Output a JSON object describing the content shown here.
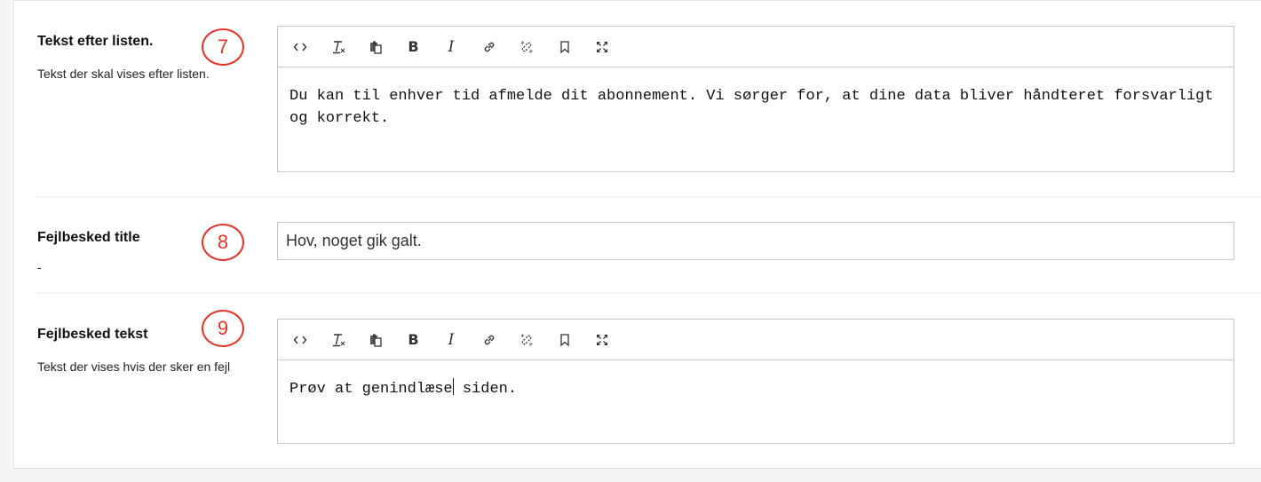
{
  "fields": [
    {
      "label": "Tekst efter listen.",
      "description": "Tekst der skal vises efter listen.",
      "badge": "7",
      "content": "Du kan til enhver tid afmelde dit abonnement. Vi sørger for, at dine data bliver håndteret forsvarligt og korrekt."
    },
    {
      "label": "Fejlbesked title",
      "description": "-",
      "badge": "8",
      "value": "Hov, noget gik galt."
    },
    {
      "label": "Fejlbesked tekst",
      "description": "Tekst der vises hvis der sker en fejl",
      "badge": "9",
      "content_before_cursor": "Prøv at genindlæse",
      "content_after_cursor": " siden."
    }
  ],
  "toolbar": {
    "bold": "B",
    "italic": "I",
    "icons": [
      "source-code-icon",
      "remove-format-icon",
      "paste-icon",
      "bold-icon",
      "italic-icon",
      "link-icon",
      "unlink-icon",
      "anchor-icon",
      "maximize-icon"
    ]
  },
  "colors": {
    "badge": "#e2342a",
    "border": "#c8c8c8",
    "background": "#f5f5f4"
  }
}
